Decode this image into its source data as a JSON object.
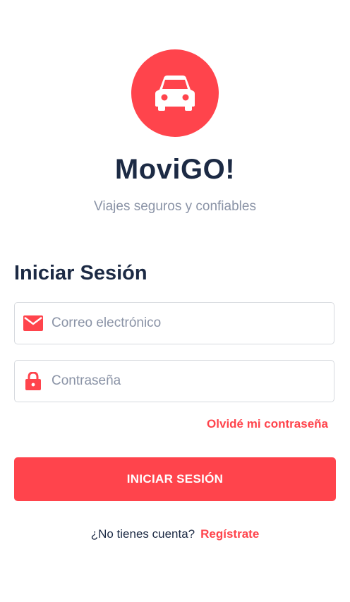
{
  "brand": {
    "name": "MoviGO!",
    "tagline": "Viajes seguros y confiables",
    "accent_color": "#ff444c",
    "logo_icon": "car-icon"
  },
  "login": {
    "heading": "Iniciar Sesión",
    "email": {
      "placeholder": "Correo electrónico",
      "value": "",
      "icon": "mail-icon"
    },
    "password": {
      "placeholder": "Contraseña",
      "value": "",
      "icon": "lock-icon"
    },
    "forgot_label": "Olvidé mi contraseña",
    "submit_label": "INICIAR SESIÓN"
  },
  "signup": {
    "question": "¿No tienes cuenta?",
    "link_label": "Regístrate"
  }
}
